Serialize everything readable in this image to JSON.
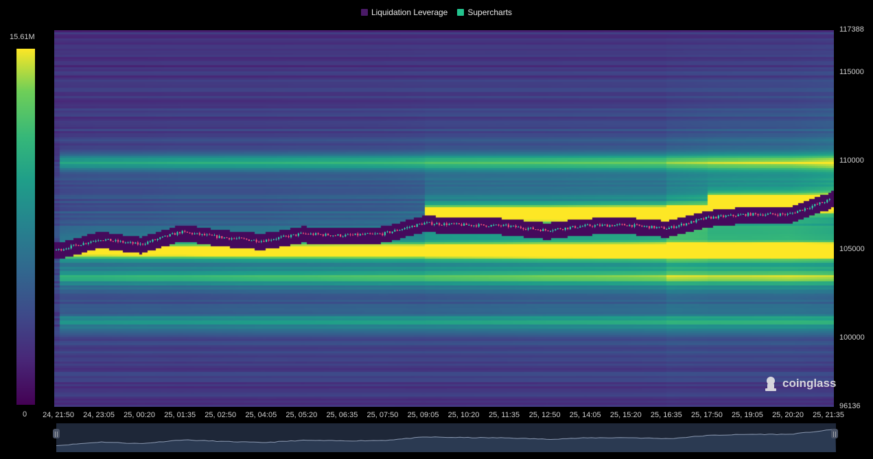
{
  "legend": {
    "items": [
      {
        "label": "Liquidation Leverage",
        "color": "#4a1a67"
      },
      {
        "label": "Supercharts",
        "color": "#23c38e"
      }
    ]
  },
  "colorbar": {
    "max_label": "15.61M",
    "min_label": "0",
    "colormap": "viridis"
  },
  "watermark": {
    "text": "coinglass",
    "icon": "coinglass-logo-icon"
  },
  "chart_data": {
    "type": "heatmap",
    "title": "",
    "xlabel": "",
    "ylabel": "",
    "x_ticks": [
      "24, 21:50",
      "24, 23:05",
      "25, 00:20",
      "25, 01:35",
      "25, 02:50",
      "25, 04:05",
      "25, 05:20",
      "25, 06:35",
      "25, 07:50",
      "25, 09:05",
      "25, 10:20",
      "25, 11:35",
      "25, 12:50",
      "25, 14:05",
      "25, 15:20",
      "25, 16:35",
      "25, 17:50",
      "25, 19:05",
      "25, 20:20",
      "25, 21:35"
    ],
    "y_ticks": [
      "117388",
      "115000",
      "110000",
      "105000",
      "100000",
      "96136"
    ],
    "ylim": [
      96136,
      117388
    ],
    "color_range": [
      0,
      15610000
    ],
    "price_path": {
      "times": [
        "24, 21:50",
        "24, 23:05",
        "25, 00:20",
        "25, 01:35",
        "25, 02:50",
        "25, 04:05",
        "25, 05:20",
        "25, 06:35",
        "25, 07:50",
        "25, 09:05",
        "25, 10:20",
        "25, 11:35",
        "25, 12:50",
        "25, 14:05",
        "25, 15:20",
        "25, 16:35",
        "25, 17:50",
        "25, 19:05",
        "25, 20:20",
        "25, 21:35",
        "25, 21:50"
      ],
      "prices": [
        105000,
        105600,
        105300,
        106000,
        105700,
        105500,
        105900,
        105800,
        105900,
        106500,
        106400,
        106350,
        106100,
        106350,
        106400,
        106200,
        106800,
        107000,
        107000,
        107800,
        108000
      ]
    },
    "liquidation_bands": [
      {
        "price": 105000,
        "intensity": 0.95,
        "from": "24, 21:50",
        "to": "25, 21:50"
      },
      {
        "price": 107100,
        "intensity": 0.95,
        "from": "25, 09:05",
        "to": "25, 17:50"
      },
      {
        "price": 107700,
        "intensity": 0.85,
        "from": "25, 17:50",
        "to": "25, 21:50"
      },
      {
        "price": 110000,
        "intensity": 0.45,
        "from": "24, 21:50",
        "to": "25, 21:50"
      },
      {
        "price": 103500,
        "intensity": 0.4,
        "from": "24, 21:50",
        "to": "25, 21:50"
      },
      {
        "price": 101000,
        "intensity": 0.35,
        "from": "24, 21:50",
        "to": "25, 21:50"
      }
    ]
  }
}
